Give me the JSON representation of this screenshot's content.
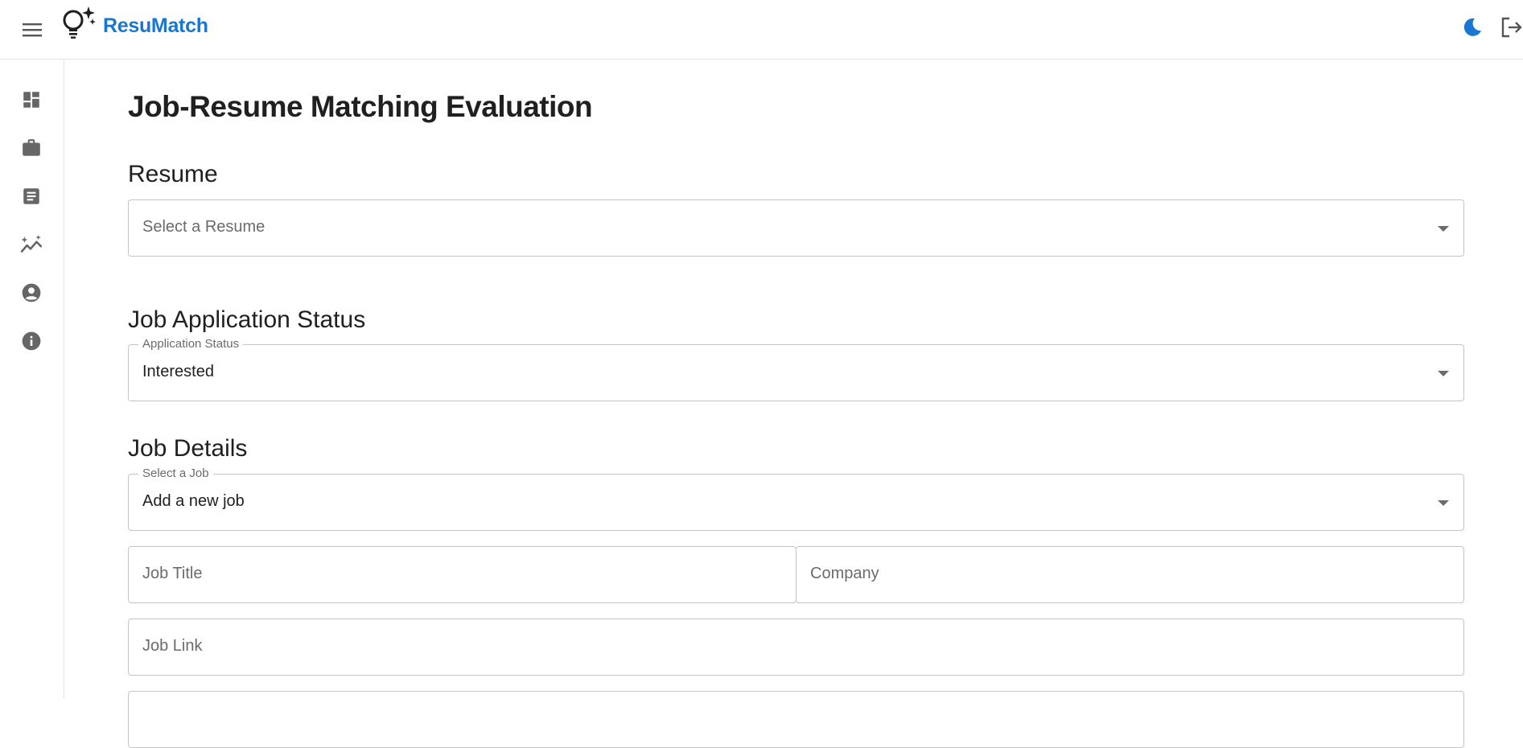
{
  "app": {
    "brand": "ResuMatch"
  },
  "icons": {
    "menu": "menu-icon",
    "logo": "lightbulb-sparkle-icon",
    "theme": "moon-icon",
    "logout": "logout-icon",
    "rail": [
      "dashboard-icon",
      "briefcase-icon",
      "document-icon",
      "analytics-icon",
      "account-icon",
      "info-icon"
    ]
  },
  "colors": {
    "brand": "#1976d2",
    "icon": "#666666",
    "border": "#c4c4c4"
  },
  "page": {
    "title": "Job-Resume Matching Evaluation"
  },
  "resume": {
    "heading": "Resume",
    "select_placeholder": "Select a Resume"
  },
  "status": {
    "heading": "Job Application Status",
    "label": "Application Status",
    "value": "Interested"
  },
  "job": {
    "heading": "Job Details",
    "select_label": "Select a Job",
    "select_value": "Add a new job",
    "title_placeholder": "Job Title",
    "company_placeholder": "Company",
    "link_placeholder": "Job Link"
  }
}
